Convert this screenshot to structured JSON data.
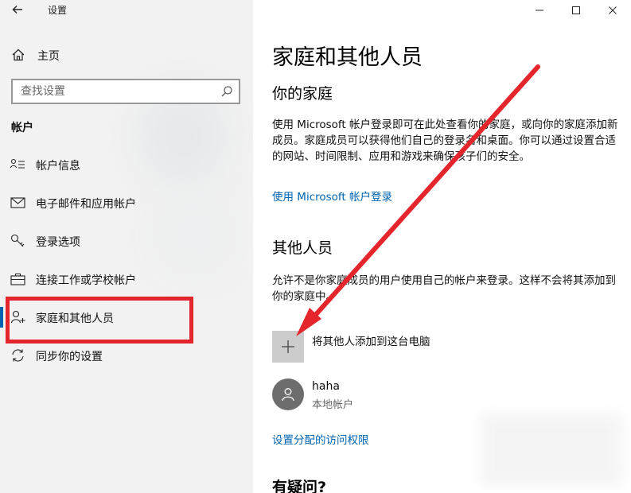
{
  "window": {
    "title": "设置",
    "back_glyph": "←",
    "controls": [
      "minimize",
      "maximize",
      "close"
    ]
  },
  "sidebar": {
    "home_label": "主页",
    "search_placeholder": "查找设置",
    "section_label": "帐户",
    "items": [
      {
        "label": "帐户信息",
        "icon": "account-info-icon",
        "active": false
      },
      {
        "label": "电子邮件和应用帐户",
        "icon": "mail-icon",
        "active": false
      },
      {
        "label": "登录选项",
        "icon": "key-icon",
        "active": false
      },
      {
        "label": "连接工作或学校帐户",
        "icon": "briefcase-icon",
        "active": false
      },
      {
        "label": "家庭和其他人员",
        "icon": "person-add-icon",
        "active": true
      },
      {
        "label": "同步你的设置",
        "icon": "sync-icon",
        "active": false
      }
    ]
  },
  "main": {
    "title": "家庭和其他人员",
    "family": {
      "heading": "你的家庭",
      "description": "使用 Microsoft 帐户登录即可在此处查看你的家庭，或向你的家庭添加新成员。家庭成员可以获得他们自己的登录名和桌面。你可以通过设置合适的网站、时间限制、应用和游戏来确保孩子们的安全。",
      "signin_link": "使用 Microsoft 帐户登录"
    },
    "others": {
      "heading": "其他人员",
      "description": "允许不是你家庭成员的用户使用自己的帐户来登录。这样不会将其添加到你的家庭中。",
      "add_label": "将其他人添加到这台电脑",
      "users": [
        {
          "name": "haha",
          "type": "本地帐户"
        }
      ],
      "access_link": "设置分配的访问权限"
    },
    "question_heading": "有疑问?"
  },
  "colors": {
    "accent": "#0063b1",
    "annotation": "#e4262c",
    "sidebar_bg": "#f2f2f2"
  }
}
